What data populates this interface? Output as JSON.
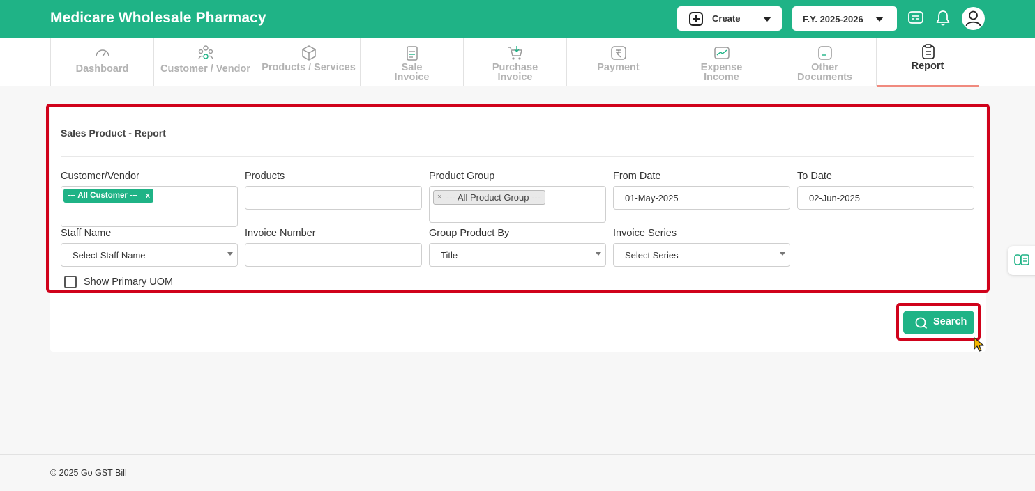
{
  "header": {
    "app_title": "Medicare Wholesale Pharmacy",
    "create_label": "Create",
    "fy_label": "F.Y. 2025-2026",
    "accent_color": "#1fb386"
  },
  "nav": {
    "tabs": [
      {
        "line1": "Dashboard",
        "line2": "",
        "icon": "gauge-icon"
      },
      {
        "line1": "Customer / Vendor",
        "line2": "",
        "icon": "users-icon"
      },
      {
        "line1": "Products / Services",
        "line2": "",
        "icon": "box-icon"
      },
      {
        "line1": "Sale",
        "line2": "Invoice",
        "icon": "invoice-icon"
      },
      {
        "line1": "Purchase",
        "line2": "Invoice",
        "icon": "cart-icon"
      },
      {
        "line1": "Payment",
        "line2": "",
        "icon": "rupee-icon"
      },
      {
        "line1": "Expense",
        "line2": "Income",
        "icon": "wallet-icon"
      },
      {
        "line1": "Other",
        "line2": "Documents",
        "icon": "document-icon"
      },
      {
        "line1": "Report",
        "line2": "",
        "icon": "clipboard-icon"
      }
    ],
    "active_tab": "Report"
  },
  "report": {
    "title": "Sales Product - Report",
    "customer_vendor": {
      "label": "Customer/Vendor",
      "chip": "--- All Customer ---",
      "chip_remove": "x"
    },
    "products": {
      "label": "Products",
      "value": ""
    },
    "product_group": {
      "label": "Product Group",
      "chip": "--- All Product Group ---",
      "chip_remove": "×"
    },
    "from_date": {
      "label": "From Date",
      "value": "01-May-2025"
    },
    "to_date": {
      "label": "To Date",
      "value": "02-Jun-2025"
    },
    "staff_name": {
      "label": "Staff Name",
      "value": "Select Staff Name"
    },
    "invoice_number": {
      "label": "Invoice Number",
      "value": ""
    },
    "group_product_by": {
      "label": "Group Product By",
      "value": "Title"
    },
    "invoice_series": {
      "label": "Invoice Series",
      "value": "Select Series"
    },
    "show_primary_uom": {
      "label": "Show Primary UOM",
      "checked": false
    },
    "search_label": "Search"
  },
  "footer": {
    "copyright": "© 2025 Go GST Bill"
  }
}
